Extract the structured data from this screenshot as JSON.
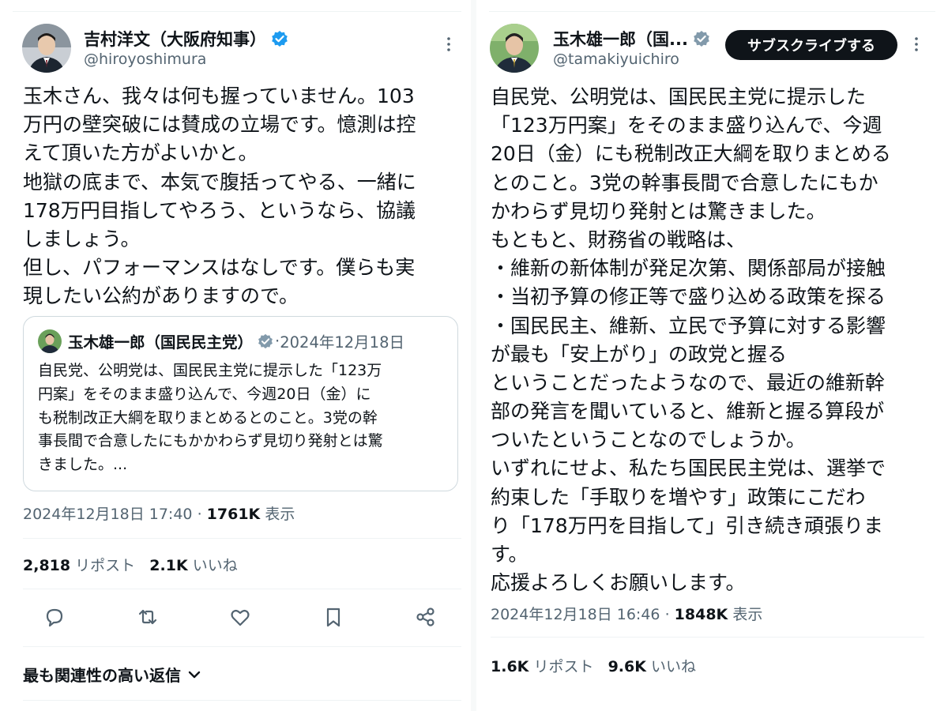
{
  "left": {
    "name": "吉村洋文（大阪府知事）",
    "handle": "@hiroyoshimura",
    "body_lines": [
      "玉木さん、我々は何も握っていません。103",
      "万円の壁突破には賛成の立場です。憶測は控",
      "えて頂いた方がよいかと。",
      "地獄の底まで、本気で腹括ってやる、一緒に",
      "178万円目指してやろう、というなら、協議",
      "しましょう。",
      "但し、パフォーマンスはなしです。僕らも実",
      "現したい公約がありますので。"
    ],
    "quote": {
      "name": "玉木雄一郎（国民民主党）",
      "separator": "·",
      "date": "2024年12月18日",
      "lines": [
        "自民党、公明党は、国民民主党に提示した「123万",
        "円案」をそのまま盛り込んで、今週20日（金）に",
        "も税制改正大綱を取りまとめるとのこと。3党の幹",
        "事長間で合意したにもかかわらず見切り発射とは驚",
        "きました。..."
      ]
    },
    "timestamp": "2024年12月18日 17:40",
    "dot": "·",
    "views_count": "1761K",
    "views_label": "表示",
    "reposts_count": "2,818",
    "reposts_label": "リポスト",
    "likes_count": "2.1K",
    "likes_label": "いいね",
    "replies_sort": "最も関連性の高い返信"
  },
  "right": {
    "name": "玉木雄一郎（国...",
    "handle": "@tamakiyuichiro",
    "subscribe_label": "サブスクライブする",
    "body_lines": [
      "自民党、公明党は、国民民主党に提示した",
      "「123万円案」をそのまま盛り込んで、今週",
      "20日（金）にも税制改正大綱を取りまとめる",
      "とのこと。3党の幹事長間で合意したにもか",
      "かわらず見切り発射とは驚きました。",
      "もともと、財務省の戦略は、",
      "・維新の新体制が発足次第、関係部局が接触",
      "・当初予算の修正等で盛り込める政策を探る",
      "・国民民主、維新、立民で予算に対する影響",
      "が最も「安上がり」の政党と握る",
      "ということだったようなので、最近の維新幹",
      "部の発言を聞いていると、維新と握る算段が",
      "ついたということなのでしょうか。",
      "いずれにせよ、私たち国民民主党は、選挙で",
      "約束した「手取りを増やす」政策にこだわ",
      "り「178万円を目指して」引き続き頑張りま",
      "す。",
      "応援よろしくお願いします。"
    ],
    "timestamp": "2024年12月18日 16:46",
    "dot": "·",
    "views_count": "1848K",
    "views_label": "表示",
    "reposts_count": "1.6K",
    "reposts_label": "リポスト",
    "likes_count": "9.6K",
    "likes_label": "いいね"
  },
  "icons": [
    "verified-icon",
    "more-icon",
    "reply-icon",
    "repost-icon",
    "like-icon",
    "bookmark-icon",
    "share-icon",
    "chevron-down-icon"
  ],
  "colors": {
    "text": "#0f1419",
    "secondary": "#536471",
    "verified": "#1d9bf0",
    "verified_gray": "#829aab",
    "border": "#cfd9de"
  }
}
